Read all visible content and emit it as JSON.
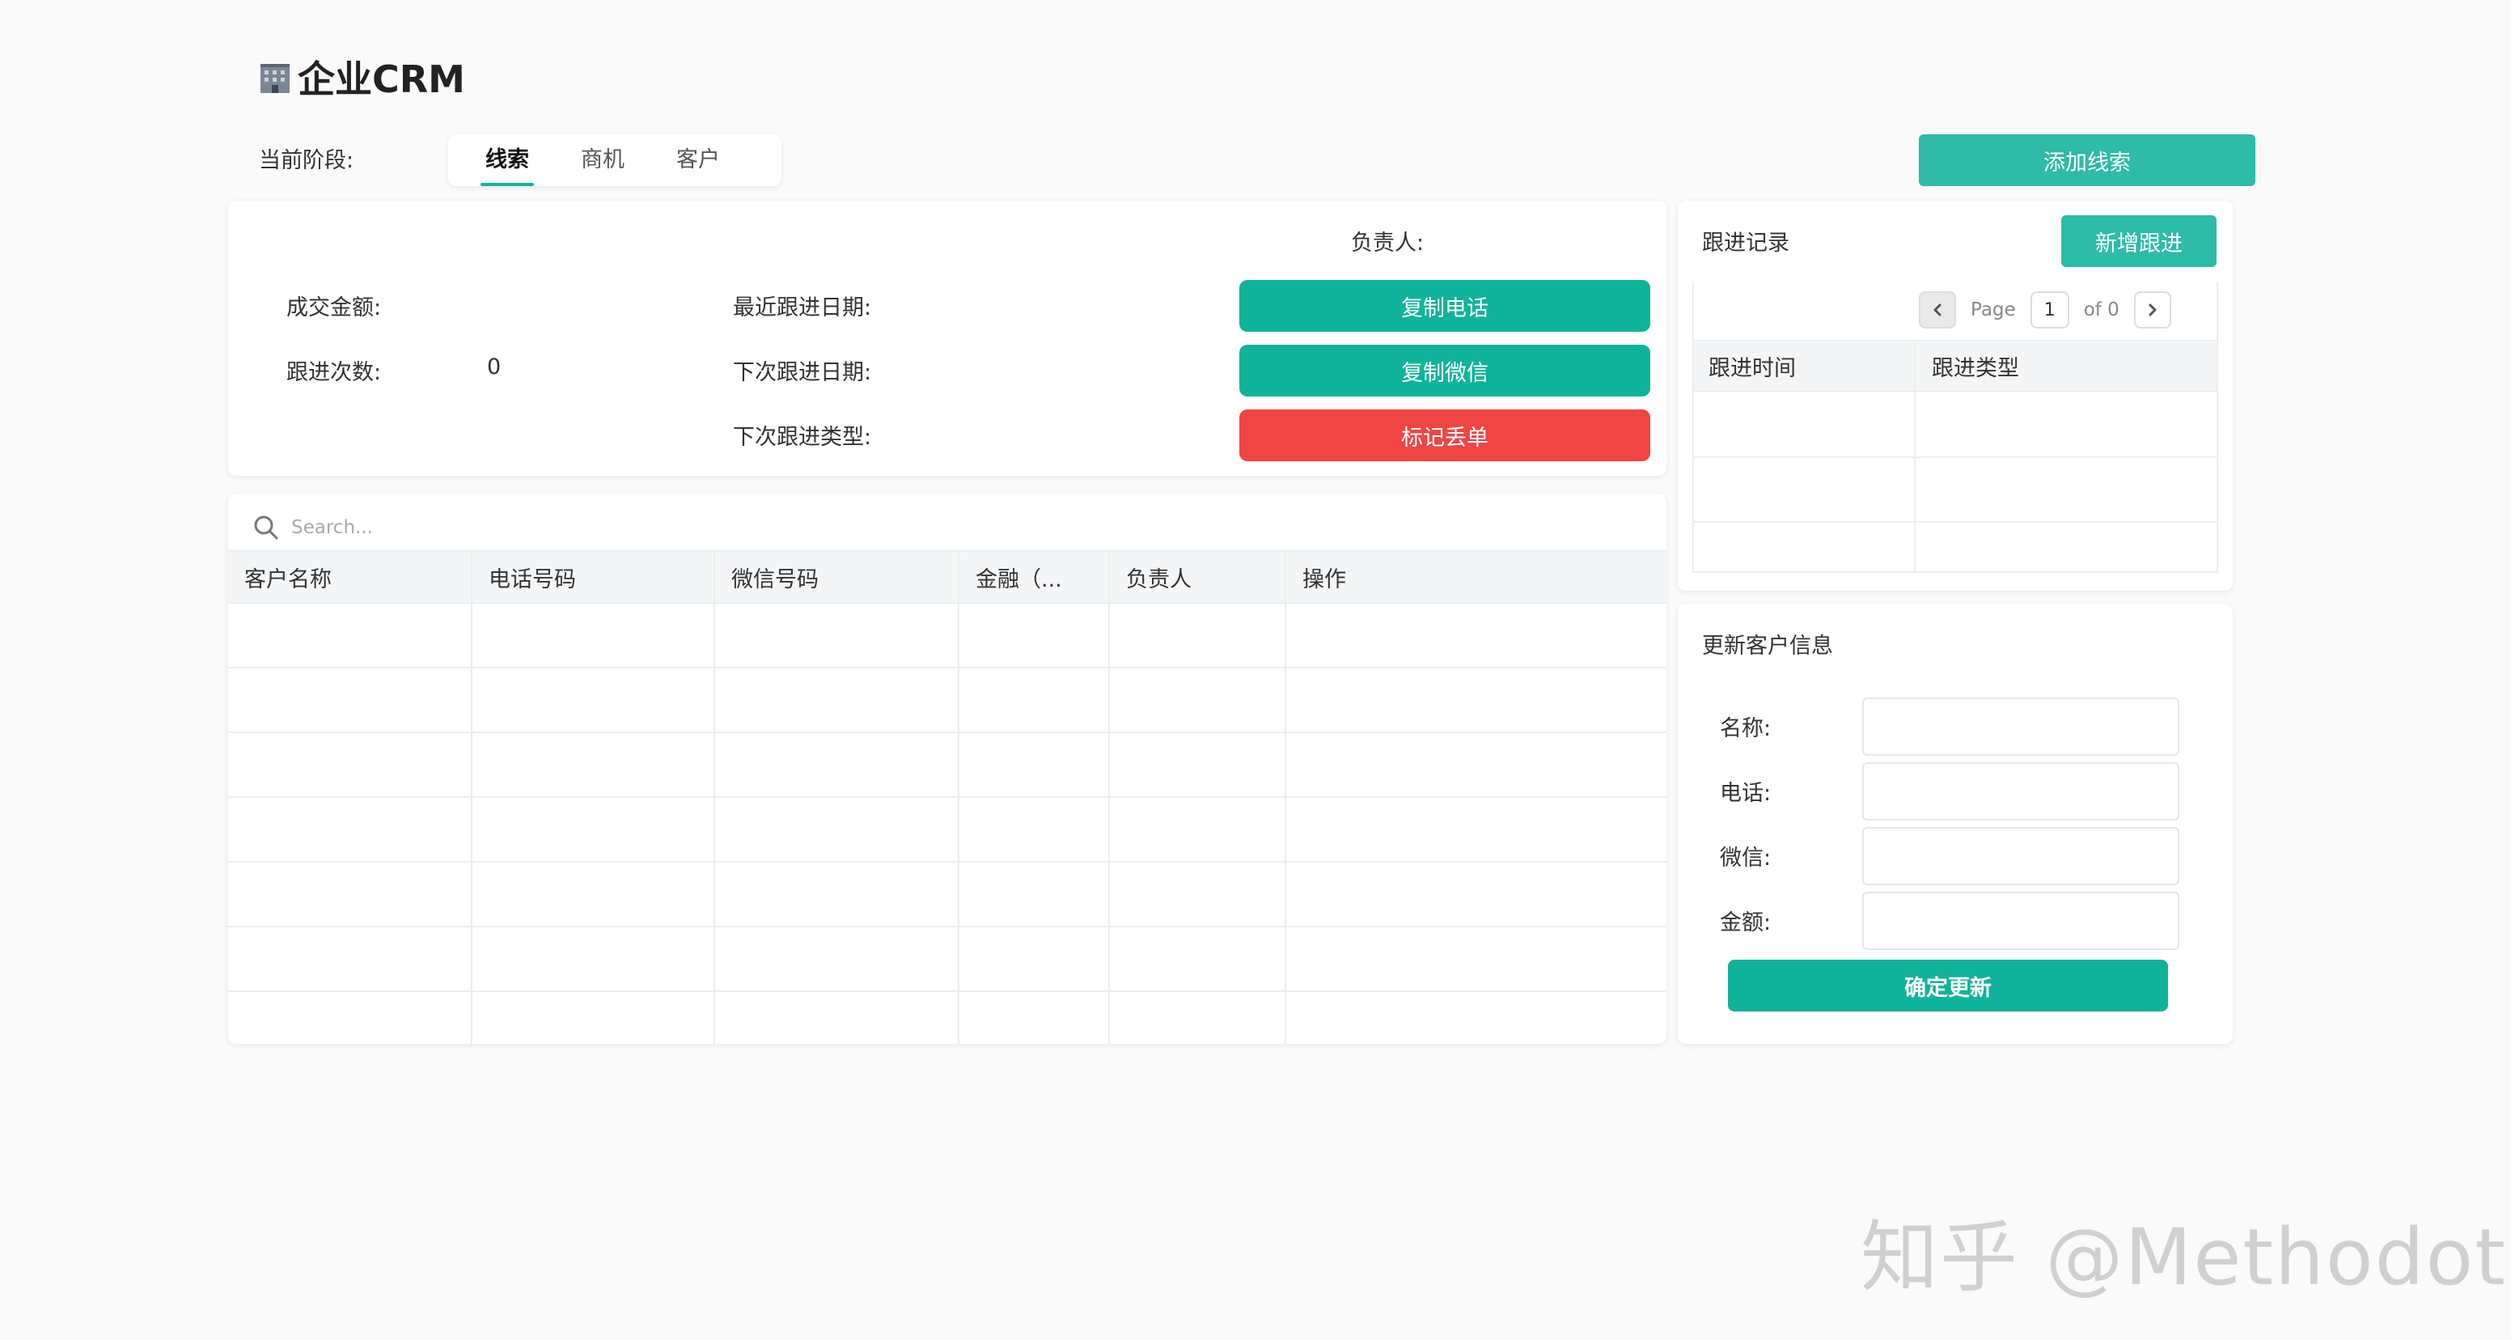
{
  "app": {
    "title": "企业CRM"
  },
  "stage": {
    "label": "当前阶段:",
    "tabs": [
      {
        "label": "线索",
        "active": true
      },
      {
        "label": "商机",
        "active": false
      },
      {
        "label": "客户",
        "active": false
      }
    ],
    "add_button": "添加线索"
  },
  "detail": {
    "owner_label": "负责人:",
    "amount_label": "成交金额:",
    "followup_count_label": "跟进次数:",
    "followup_count_value": "0",
    "last_followup_label": "最近跟进日期:",
    "next_followup_label": "下次跟进日期:",
    "next_followup_type_label": "下次跟进类型:",
    "copy_phone_button": "复制电话",
    "copy_wechat_button": "复制微信",
    "mark_lost_button": "标记丢单"
  },
  "main_table": {
    "search_placeholder": "Search...",
    "columns": [
      "客户名称",
      "电话号码",
      "微信号码",
      "金融（...",
      "负责人",
      "操作"
    ],
    "rows": []
  },
  "followup": {
    "title": "跟进记录",
    "add_button": "新增跟进",
    "pager": {
      "page_label": "Page",
      "page_value": "1",
      "of_label": "of 0"
    },
    "columns": [
      "跟进时间",
      "跟进类型"
    ],
    "rows": []
  },
  "update_form": {
    "title": "更新客户信息",
    "fields": [
      {
        "label": "名称:",
        "value": ""
      },
      {
        "label": "电话:",
        "value": ""
      },
      {
        "label": "微信:",
        "value": ""
      },
      {
        "label": "金额:",
        "value": ""
      }
    ],
    "submit_button": "确定更新"
  },
  "watermark": "知乎 @Methodot",
  "colors": {
    "primary": "#10b39a",
    "primary_light": "#2ebba7",
    "danger": "#f04545",
    "background": "#fafafa"
  }
}
